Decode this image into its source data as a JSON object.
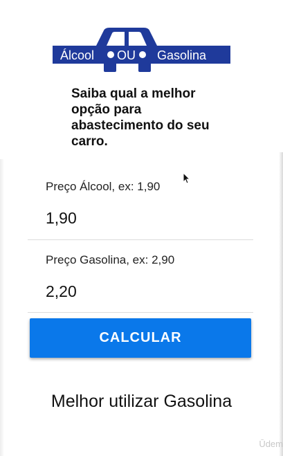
{
  "logo": {
    "left_word": "Álcool",
    "middle_word": "OU",
    "right_word": "Gasolina",
    "color": "#1f3a9b"
  },
  "intro_text": "Saiba qual a melhor opção para abastecimento do seu carro.",
  "form": {
    "alcohol": {
      "label": "Preço Álcool, ex: 1,90",
      "value": "1,90"
    },
    "gasoline": {
      "label": "Preço Gasolina, ex: 2,90",
      "value": "2,20"
    },
    "calculate_label": "CALCULAR",
    "button_color": "#0a78ea"
  },
  "result_text": "Melhor utilizar Gasolina",
  "watermark": "Ūdem"
}
